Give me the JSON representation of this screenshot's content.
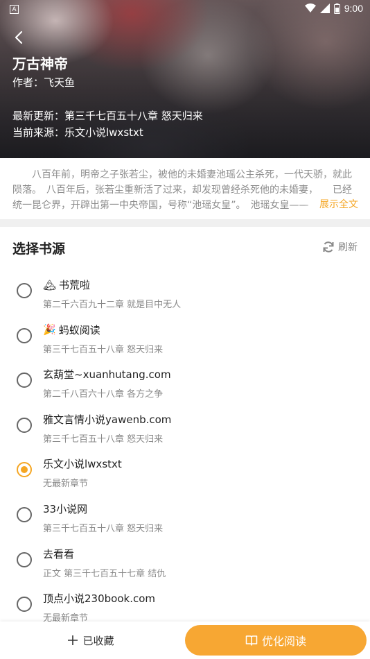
{
  "status_bar": {
    "time": "9:00",
    "a_icon": "A"
  },
  "header": {
    "title": "万古神帝",
    "author": "作者：飞天鱼",
    "latest": "最新更新：第三千七百五十八章 怒天归来",
    "source": "当前来源：乐文小说lwxstxt"
  },
  "description": {
    "text": "八百年前，明帝之子张若尘，被他的未婚妻池瑶公主杀死，一代天骄，就此陨落。　八百年后，张若尘重新活了过来，却发现曾经杀死他的未婚妻，　　已经统一昆仑界，开辟出第一中央帝国，号称“池瑶女皇”。　池瑶女皇——",
    "expand_label": "展示全文"
  },
  "sources": {
    "title": "选择书源",
    "refresh_label": "刷新",
    "items": [
      {
        "name": "书荒啦",
        "icon": "🏔",
        "latest": "第二千六百九十二章 就是目中无人",
        "selected": false
      },
      {
        "name": "蚂蚁阅读",
        "icon": "🎉",
        "latest": "第三千七百五十八章 怒天归来",
        "selected": false
      },
      {
        "name": "玄葫堂~xuanhutang.com",
        "icon": "",
        "latest": "第二千八百六十八章 各方之争",
        "selected": false
      },
      {
        "name": "雅文言情小说yawenb.com",
        "icon": "",
        "latest": "第三千七百五十八章 怒天归来",
        "selected": false
      },
      {
        "name": "乐文小说lwxstxt",
        "icon": "",
        "latest": "无最新章节",
        "selected": true
      },
      {
        "name": "33小说网",
        "icon": "",
        "latest": "第三千七百五十八章 怒天归来",
        "selected": false
      },
      {
        "name": "去看看",
        "icon": "",
        "latest": "正文 第三千七百五十七章 结仇",
        "selected": false
      },
      {
        "name": "顶点小说230book.com",
        "icon": "",
        "latest": "无最新章节",
        "selected": false
      }
    ]
  },
  "bottom_bar": {
    "collect_label": "已收藏",
    "read_label": "优化阅读"
  },
  "colors": {
    "accent": "#f7a733",
    "muted": "#888888"
  }
}
